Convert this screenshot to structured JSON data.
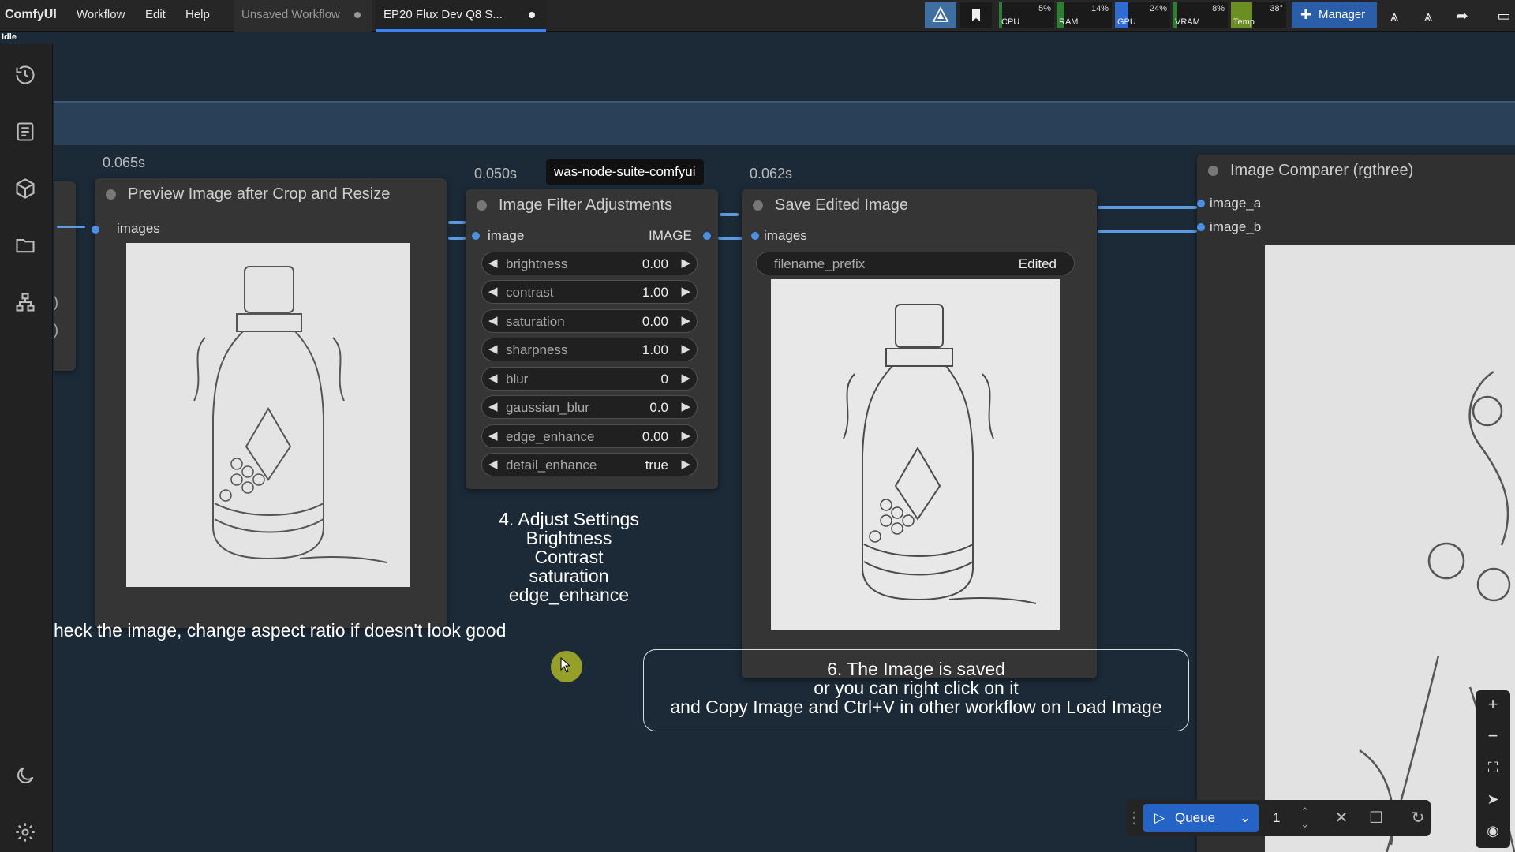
{
  "app": {
    "name": "ComfyUI",
    "status": "Idle"
  },
  "menu": [
    "Workflow",
    "Edit",
    "Help"
  ],
  "tabs": [
    {
      "label": "Unsaved Workflow",
      "active": false
    },
    {
      "label": "EP20 Flux Dev Q8 S...",
      "active": true
    }
  ],
  "stats": [
    {
      "label": "CPU",
      "value": "5%",
      "fraction": 0.05,
      "color": "#2f7d32"
    },
    {
      "label": "RAM",
      "value": "14%",
      "fraction": 0.14,
      "color": "#2f7d32"
    },
    {
      "label": "GPU",
      "value": "24%",
      "fraction": 0.24,
      "color": "#2f6bd0"
    },
    {
      "label": "VRAM",
      "value": "8%",
      "fraction": 0.08,
      "color": "#2f7d32"
    },
    {
      "label": "Temp",
      "value": "38°",
      "fraction": 0.38,
      "color": "#6b8e23"
    }
  ],
  "manager_label": "Manager",
  "nodes": {
    "preview": {
      "timing": "0.065s",
      "title": "Preview Image after Crop and Resize",
      "input": "images"
    },
    "filter": {
      "timing": "0.050s",
      "title": "Image Filter Adjustments",
      "input": "image",
      "output": "IMAGE",
      "widgets": [
        {
          "name": "brightness",
          "value": "0.00"
        },
        {
          "name": "contrast",
          "value": "1.00"
        },
        {
          "name": "saturation",
          "value": "0.00"
        },
        {
          "name": "sharpness",
          "value": "1.00"
        },
        {
          "name": "blur",
          "value": "0"
        },
        {
          "name": "gaussian_blur",
          "value": "0.0"
        },
        {
          "name": "edge_enhance",
          "value": "0.00"
        },
        {
          "name": "detail_enhance",
          "value": "true"
        }
      ]
    },
    "save": {
      "timing": "0.062s",
      "title": "Save Edited Image",
      "input": "images",
      "widget": {
        "name": "filename_prefix",
        "value": "Edited"
      }
    },
    "comparer": {
      "title": "Image Comparer (rgthree)",
      "inputs": [
        "image_a",
        "image_b"
      ]
    }
  },
  "tooltip": "was-node-suite-comfyui",
  "notes": {
    "step4": [
      "4. Adjust Settings",
      "Brightness",
      "Contrast",
      "saturation",
      "edge_enhance"
    ],
    "step3": "heck the image, change aspect ratio if doesn't look good",
    "step6": [
      "6. The Image is saved",
      "or you can right click on it",
      "and Copy Image and Ctrl+V in other workflow on Load Image"
    ]
  },
  "queue": {
    "label": "Queue",
    "count": "1"
  },
  "colors": {
    "accent": "#3b82f6",
    "wire": "#5b9be0",
    "canvas": "#1c2a38",
    "node": "#353535"
  }
}
